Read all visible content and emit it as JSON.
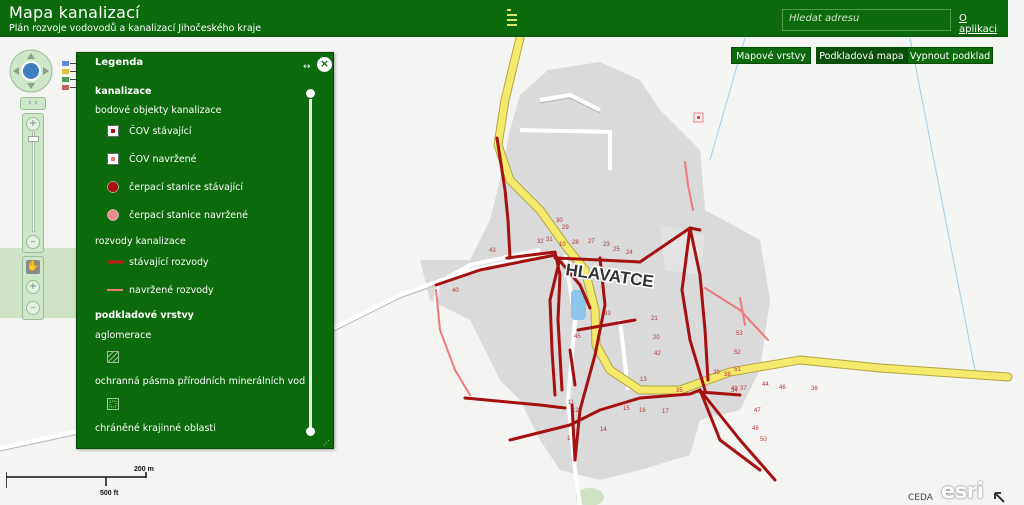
{
  "header": {
    "title": "Mapa kanalizací",
    "subtitle": "Plán rozvoje vodovodů a kanalizací Jihočeského kraje",
    "search_placeholder": "Hledat adresu",
    "about_link": "O aplikaci"
  },
  "toolbar": {
    "map_layers": "Mapové vrstvy",
    "basemap": "Podkladová mapa",
    "basemap_off": "Vypnout podklad"
  },
  "legend": {
    "title": "Legenda",
    "section_sewer": "kanalizace",
    "point_objects": "bodové objekty kanalizace",
    "cov_existing": "ČOV stávající",
    "cov_planned": "ČOV navržené",
    "pump_existing": "čerpací stanice stávající",
    "pump_planned": "čerpací stanice navržené",
    "distribution": "rozvody kanalizace",
    "dist_existing": "stávající rozvody",
    "dist_planned": "navržené rozvody",
    "section_base": "podkladové vrstvy",
    "agglomeration": "aglomerace",
    "protection_zones": "ochranná pásma přírodních minerálních vod",
    "landscape_areas": "chráněné krajinné oblasti"
  },
  "map": {
    "place_name": "HLAVATCE",
    "scale_metric": "200 m",
    "scale_imperial": "500 ft",
    "attribution": "CEDA",
    "provider_logo": "esri",
    "house_numbers": [
      "43",
      "40",
      "30",
      "10",
      "29",
      "28",
      "27",
      "23",
      "25",
      "24",
      "32",
      "31",
      "33",
      "21",
      "20",
      "42",
      "13",
      "11",
      "39",
      "38",
      "34",
      "37",
      "44",
      "46",
      "36",
      "53",
      "52",
      "51",
      "49",
      "48",
      "50",
      "47",
      "1",
      "12",
      "15",
      "16",
      "17",
      "14",
      "35",
      "45"
    ]
  },
  "colors": {
    "header_bg": "#0b6a0b",
    "existing_sewer": "#a51010",
    "planned_sewer": "#f07a7a",
    "main_road": "#f5e96b",
    "built_up_area": "#dcdcdc"
  }
}
